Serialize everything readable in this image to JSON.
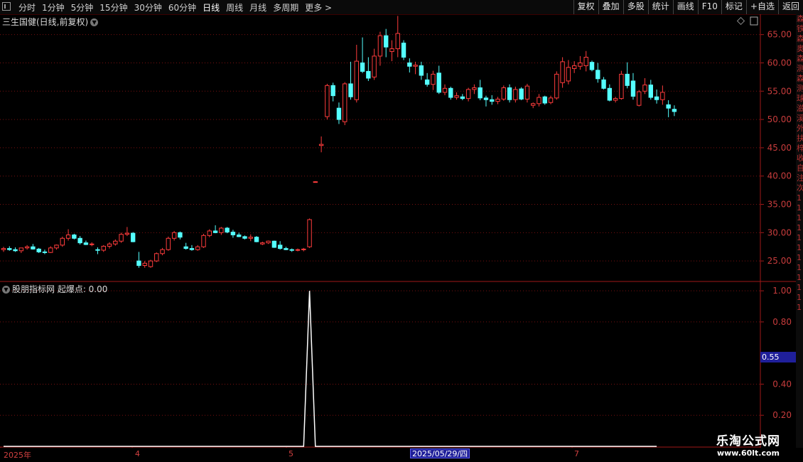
{
  "toolbar": {
    "periods": [
      "分时",
      "1分钟",
      "5分钟",
      "15分钟",
      "30分钟",
      "60分钟",
      "日线",
      "周线",
      "月线",
      "多周期",
      "更多 >"
    ],
    "active_period": "日线",
    "tools": [
      "复权",
      "叠加",
      "多股",
      "统计",
      "画线",
      "F10",
      "标记",
      "+自选",
      "返回"
    ]
  },
  "stock": {
    "title": "三生国健(日线,前复权)"
  },
  "indicator": {
    "title": "股朋指标网 起爆点: 0.00"
  },
  "cursor_value": "0.55",
  "x_axis": {
    "labels": [
      "2025年",
      "4",
      "5",
      "7"
    ],
    "cursor_date": "2025/05/29/四"
  },
  "right_strip": [
    "森",
    "铁",
    "森",
    "奥",
    "森",
    "测",
    "森",
    "测",
    "球",
    "滋",
    "溪",
    "外",
    "扶",
    "梓",
    "收",
    "自",
    "注",
    "次",
    "1",
    "1",
    "1",
    "1",
    "1",
    "1",
    "1",
    "1",
    "1",
    "1",
    "1",
    "1"
  ],
  "watermark": {
    "line1": "乐淘公式网",
    "line2": "www.60lt.com"
  },
  "colors": {
    "up": "#ff3c3c",
    "down": "#54ffff",
    "grid": "#7a1010",
    "axis": "#a01818",
    "axis_text": "#c83c3c"
  },
  "chart_data": {
    "type": "candlestick",
    "y_ticks": [
      "65.00",
      "60.00",
      "55.00",
      "50.00",
      "45.00",
      "40.00",
      "35.00",
      "30.00",
      "25.00"
    ],
    "ylim": [
      21.5,
      68.6
    ],
    "candles": [
      [
        27,
        27.5,
        26.6,
        27.2
      ],
      [
        27.2,
        27.6,
        26.8,
        27.0
      ],
      [
        27.0,
        27.4,
        26.6,
        26.8
      ],
      [
        26.8,
        27.2,
        26.4,
        27.3
      ],
      [
        27.3,
        27.8,
        27.0,
        27.5
      ],
      [
        27.5,
        28.0,
        27.0,
        27.1
      ],
      [
        27.1,
        27.3,
        26.4,
        26.6
      ],
      [
        26.6,
        27.0,
        26.2,
        26.5
      ],
      [
        26.5,
        27.6,
        26.4,
        27.3
      ],
      [
        27.3,
        27.9,
        27.0,
        27.8
      ],
      [
        27.8,
        29.3,
        27.5,
        29.0
      ],
      [
        29.0,
        30.6,
        28.6,
        29.6
      ],
      [
        29.6,
        29.8,
        28.8,
        29.0
      ],
      [
        29.0,
        29.4,
        27.9,
        28.2
      ],
      [
        28.2,
        28.6,
        27.8,
        27.9
      ],
      [
        27.9,
        28.3,
        27.6,
        28.0
      ],
      [
        27.0,
        27.4,
        26.2,
        26.9
      ],
      [
        26.9,
        27.8,
        26.6,
        27.6
      ],
      [
        27.6,
        28.3,
        27.2,
        28.0
      ],
      [
        28.0,
        28.8,
        27.7,
        28.5
      ],
      [
        28.5,
        30.0,
        28.2,
        29.7
      ],
      [
        29.7,
        31.0,
        29.4,
        29.9
      ],
      [
        29.9,
        30.1,
        28.3,
        28.4
      ],
      [
        25.0,
        26.6,
        23.8,
        24.2
      ],
      [
        24.2,
        25.0,
        23.8,
        24.6
      ],
      [
        24.0,
        25.2,
        23.8,
        25.0
      ],
      [
        25.0,
        26.5,
        24.8,
        26.3
      ],
      [
        26.3,
        27.3,
        26.0,
        27.0
      ],
      [
        27.0,
        29.3,
        26.8,
        29.0
      ],
      [
        29.0,
        30.3,
        28.6,
        30.0
      ],
      [
        30.0,
        30.2,
        28.8,
        29.2
      ],
      [
        27.5,
        28.2,
        27.0,
        27.2
      ],
      [
        27.2,
        27.8,
        26.8,
        27.0
      ],
      [
        27.0,
        27.8,
        26.8,
        27.5
      ],
      [
        27.5,
        29.8,
        27.3,
        29.5
      ],
      [
        29.5,
        30.6,
        29.2,
        30.3
      ],
      [
        30.3,
        31.3,
        29.9,
        30.0
      ],
      [
        30.0,
        31.0,
        29.6,
        30.8
      ],
      [
        30.8,
        31.0,
        29.9,
        30.1
      ],
      [
        30.1,
        30.5,
        29.1,
        29.6
      ],
      [
        29.6,
        30.0,
        29.2,
        29.3
      ],
      [
        29.3,
        29.5,
        28.8,
        29.0
      ],
      [
        29.0,
        29.7,
        28.5,
        29.2
      ],
      [
        29.2,
        29.4,
        28.3,
        28.4
      ],
      [
        28.0,
        28.4,
        27.8,
        28.2
      ],
      [
        28.2,
        28.6,
        28.0,
        28.5
      ],
      [
        28.5,
        28.6,
        27.3,
        27.4
      ],
      [
        27.8,
        28.5,
        27.0,
        27.2
      ],
      [
        27.2,
        27.5,
        26.9,
        27.0
      ],
      [
        27.0,
        27.2,
        26.6,
        26.9
      ],
      [
        26.9,
        27.2,
        26.7,
        27.0
      ],
      [
        27.0,
        27.3,
        26.7,
        27.1
      ],
      [
        27.5,
        32.5,
        27.3,
        32.3
      ],
      [
        39.0,
        39.1,
        38.9,
        39.0
      ],
      [
        45.4,
        47.0,
        44.2,
        45.6
      ],
      [
        50.5,
        56.3,
        50.0,
        56.0
      ],
      [
        56.0,
        56.5,
        53.2,
        54.2
      ],
      [
        52.0,
        53.0,
        49.2,
        50.0
      ],
      [
        49.6,
        56.6,
        49.0,
        56.3
      ],
      [
        56.3,
        60.2,
        53.5,
        54.0
      ],
      [
        53.5,
        63.2,
        53.0,
        60.3
      ],
      [
        60.0,
        64.5,
        58.2,
        58.5
      ],
      [
        58.5,
        61.0,
        56.8,
        57.3
      ],
      [
        57.5,
        62.5,
        57.0,
        61.2
      ],
      [
        61.2,
        65.5,
        59.5,
        64.8
      ],
      [
        64.8,
        66.0,
        61.0,
        62.8
      ],
      [
        62.0,
        64.0,
        60.3,
        62.5
      ],
      [
        62.5,
        68.3,
        61.0,
        65.2
      ],
      [
        63.5,
        64.0,
        60.5,
        61.0
      ],
      [
        60.0,
        60.8,
        58.3,
        59.4
      ],
      [
        59.4,
        60.2,
        58.0,
        59.6
      ],
      [
        59.5,
        60.2,
        57.0,
        57.8
      ],
      [
        57.0,
        58.2,
        55.8,
        56.2
      ],
      [
        56.2,
        58.6,
        55.2,
        58.0
      ],
      [
        58.2,
        59.5,
        54.5,
        54.8
      ],
      [
        54.8,
        56.2,
        54.3,
        55.5
      ],
      [
        55.5,
        55.8,
        53.5,
        53.9
      ],
      [
        53.9,
        54.8,
        53.5,
        54.2
      ],
      [
        54.0,
        54.5,
        53.4,
        53.7
      ],
      [
        53.7,
        55.6,
        53.2,
        55.3
      ],
      [
        55.3,
        56.2,
        54.5,
        55.6
      ],
      [
        55.6,
        57.0,
        53.4,
        53.8
      ],
      [
        53.8,
        54.2,
        52.3,
        53.5
      ],
      [
        53.5,
        54.3,
        52.6,
        53.2
      ],
      [
        53.2,
        54.0,
        52.7,
        53.6
      ],
      [
        53.6,
        56.0,
        53.3,
        55.6
      ],
      [
        55.6,
        56.2,
        53.0,
        53.5
      ],
      [
        53.5,
        55.8,
        53.0,
        55.3
      ],
      [
        55.4,
        55.7,
        53.4,
        53.6
      ],
      [
        53.6,
        56.3,
        53.0,
        55.9
      ],
      [
        52.5,
        53.0,
        52.0,
        52.8
      ],
      [
        52.8,
        54.5,
        52.3,
        53.9
      ],
      [
        54.0,
        54.2,
        52.6,
        52.9
      ],
      [
        53.0,
        54.2,
        52.7,
        53.8
      ],
      [
        53.8,
        58.5,
        53.5,
        58.0
      ],
      [
        56.5,
        61.0,
        55.6,
        60.2
      ],
      [
        56.8,
        60.5,
        56.2,
        59.2
      ],
      [
        59.0,
        60.3,
        58.2,
        59.5
      ],
      [
        59.4,
        61.2,
        58.8,
        60.0
      ],
      [
        59.5,
        62.1,
        58.5,
        61.0
      ],
      [
        60.1,
        60.4,
        58.5,
        58.8
      ],
      [
        58.7,
        60.0,
        56.5,
        57.2
      ],
      [
        57.0,
        57.5,
        55.3,
        55.5
      ],
      [
        55.5,
        56.2,
        53.2,
        53.4
      ],
      [
        53.4,
        54.0,
        53.0,
        53.7
      ],
      [
        53.7,
        58.6,
        53.5,
        58.0
      ],
      [
        58.0,
        60.1,
        55.5,
        56.0
      ],
      [
        56.8,
        58.2,
        53.5,
        54.1
      ],
      [
        52.5,
        55.2,
        52.3,
        54.9
      ],
      [
        55.0,
        57.3,
        54.5,
        56.1
      ],
      [
        56.1,
        57.0,
        53.5,
        53.9
      ],
      [
        54.0,
        55.3,
        52.8,
        53.5
      ],
      [
        53.5,
        56.0,
        52.6,
        54.8
      ],
      [
        52.6,
        53.4,
        50.4,
        52.0
      ],
      [
        51.8,
        52.5,
        50.6,
        51.4
      ]
    ],
    "indicator": {
      "name": "起爆点",
      "y_ticks": [
        "1.00",
        "0.80",
        "0.40",
        "0.20"
      ],
      "ylim": [
        0,
        1.06
      ],
      "values_sparse": {
        "52": 1.0
      },
      "length": 112
    }
  }
}
